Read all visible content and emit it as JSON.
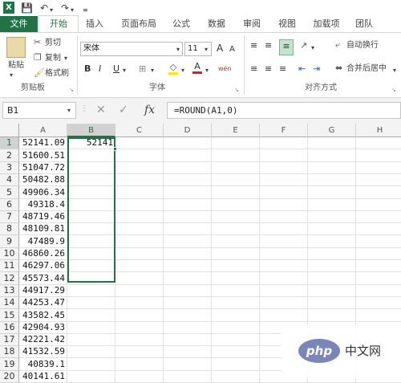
{
  "colors": {
    "accent": "#217346",
    "tab_text": "#444444",
    "selection": "#217346"
  },
  "quick_access": {
    "app_icon": "X",
    "save_icon": "save-icon",
    "undo_icon": "undo-icon",
    "redo_icon": "redo-icon",
    "customize_icon": "customize-qat-icon"
  },
  "tabs": [
    "文件",
    "开始",
    "插入",
    "页面布局",
    "公式",
    "数据",
    "审阅",
    "视图",
    "加载项",
    "团队"
  ],
  "ribbon": {
    "clipboard": {
      "paste": "粘贴",
      "cut": "剪切",
      "copy": "复制",
      "format_painter": "格式刷",
      "label": "剪贴板"
    },
    "font": {
      "name": "宋体",
      "size": "11",
      "grow": "A",
      "shrink": "A",
      "bold": "B",
      "italic": "I",
      "underline": "U",
      "border_icon": "borders-icon",
      "fill_icon": "fill-color-icon",
      "font_color": "A",
      "phonetic": "wén",
      "label": "字体"
    },
    "alignment": {
      "wrap_text": "自动换行",
      "merge_center": "合并后居中",
      "label": "对齐方式"
    }
  },
  "formula_bar": {
    "name_box": "B1",
    "cancel": "✕",
    "enter": "✓",
    "fx": "fx",
    "formula": "=ROUND(A1,0)"
  },
  "grid": {
    "columns": [
      "A",
      "B",
      "C",
      "D",
      "E",
      "F",
      "G",
      "H"
    ],
    "rows": [
      "1",
      "2",
      "3",
      "4",
      "5",
      "6",
      "7",
      "8",
      "9",
      "10",
      "11",
      "12",
      "13",
      "14",
      "15",
      "16",
      "17",
      "18",
      "19",
      "20"
    ],
    "col_a": [
      "52141.09",
      "51600.51",
      "51047.72",
      "50482.88",
      "49906.34",
      "49318.4",
      "48719.46",
      "48109.81",
      "47489.9",
      "46860.26",
      "46297.06",
      "45573.44",
      "44917.29",
      "44253.47",
      "43582.45",
      "42904.93",
      "42221.42",
      "41532.59",
      "40839.1",
      "40141.61"
    ],
    "col_b": [
      "52141",
      "",
      "",
      "",
      "",
      "",
      "",
      "",
      "",
      "",
      "",
      "",
      "",
      "",
      "",
      "",
      "",
      "",
      "",
      ""
    ],
    "selected_cell": "B1"
  },
  "watermark": {
    "php": "php",
    "text": "中文网"
  }
}
